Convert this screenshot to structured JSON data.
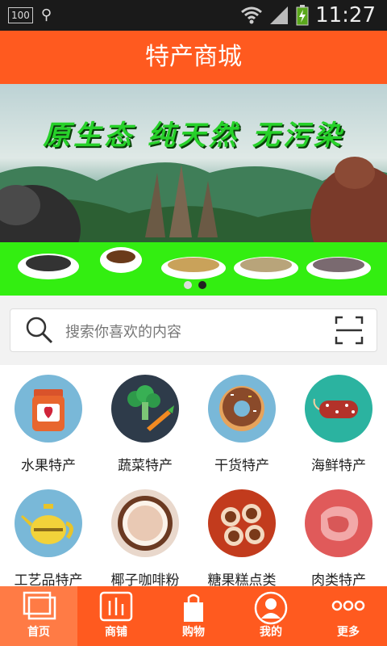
{
  "status": {
    "battery_left": "100",
    "time": "11:27"
  },
  "header": {
    "title": "特产商城"
  },
  "banner": {
    "slogan": "原生态 纯天然 无污染",
    "active_dot": 2,
    "dot_count": 2
  },
  "search": {
    "placeholder": "搜索你喜欢的内容"
  },
  "categories": [
    {
      "label": "水果特产",
      "icon": "jam-jar-icon",
      "bg": "#79b8d8"
    },
    {
      "label": "蔬菜特产",
      "icon": "broccoli-carrot-icon",
      "bg": "#2e3b4a"
    },
    {
      "label": "干货特产",
      "icon": "donut-icon",
      "bg": "#79b8d8"
    },
    {
      "label": "海鲜特产",
      "icon": "sausage-icon",
      "bg": "#2bb3a0"
    },
    {
      "label": "工艺品特产",
      "icon": "teapot-icon",
      "bg": "#79b8d8"
    },
    {
      "label": "椰子咖啡粉",
      "icon": "coconut-icon",
      "bg": "#e9d8cc"
    },
    {
      "label": "糖果糕点类",
      "icon": "swiss-roll-icon",
      "bg": "#c23b1d"
    },
    {
      "label": "肉类特产",
      "icon": "meat-icon",
      "bg": "#e05a5a"
    }
  ],
  "tabs": [
    {
      "label": "首页",
      "icon": "home-pages-icon",
      "active": true
    },
    {
      "label": "商铺",
      "icon": "store-chart-icon",
      "active": false
    },
    {
      "label": "购物",
      "icon": "shopping-bag-icon",
      "active": false
    },
    {
      "label": "我的",
      "icon": "user-icon",
      "active": false
    },
    {
      "label": "更多",
      "icon": "more-dots-icon",
      "active": false
    }
  ],
  "colors": {
    "brand": "#ff5a1f",
    "active_tab": "#ff7b45",
    "banner_strip": "#33ee11"
  }
}
